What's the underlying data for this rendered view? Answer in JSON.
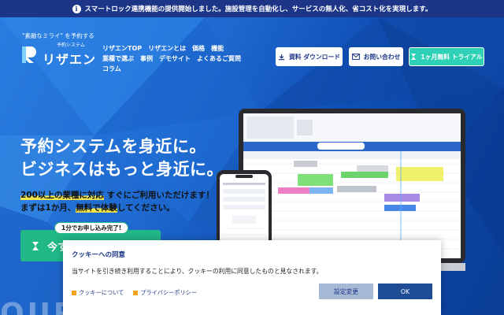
{
  "announcement": {
    "text": "スマートロック連携機能の提供開始しました。施設管理を自動化し、サービスの無人化、省コスト化を実現します。",
    "icon": "info-icon"
  },
  "header": {
    "tagline": "\"素敵なミライ\" を予約する",
    "logo_sub": "予約システム",
    "logo_name": "リザエン",
    "nav": [
      "リザエンTOP",
      "リザエンとは",
      "価格",
      "機能",
      "業種で選ぶ",
      "事例",
      "デモサイト",
      "よくあるご質問",
      "コラム"
    ],
    "buttons": {
      "document": "資料 ダウンロード",
      "contact": "お問い合わせ",
      "trial": "1ヶ月無料 トライアル"
    }
  },
  "hero": {
    "headline_1": "予約システムを身近に。",
    "headline_2": "ビジネスはもっと身近に。",
    "sub_1_hl": "200以上の業種に対応",
    "sub_1_rest": " すぐにご利用いただけます！",
    "sub_2_a": "まずは1か月、",
    "sub_2_hl": "無料で体験",
    "sub_2_b": "してください。",
    "cta_badge": "1分でお申し込み完了!",
    "cta_label": "今す",
    "watermark": "OUR CLIENTS"
  },
  "cookie": {
    "title": "クッキーへの同意",
    "text": "当サイトを引き続き利用することにより、クッキーの利用に同意したものと見なされます。",
    "link_about": "クッキーについて",
    "link_privacy": "プライバシーポリシー",
    "settings_label": "設定変更",
    "ok_label": "OK"
  },
  "colors": {
    "topbar": "#1c3587",
    "trial": "#2ed1b5",
    "cta": "#21b888",
    "ok": "#1f4d95"
  }
}
